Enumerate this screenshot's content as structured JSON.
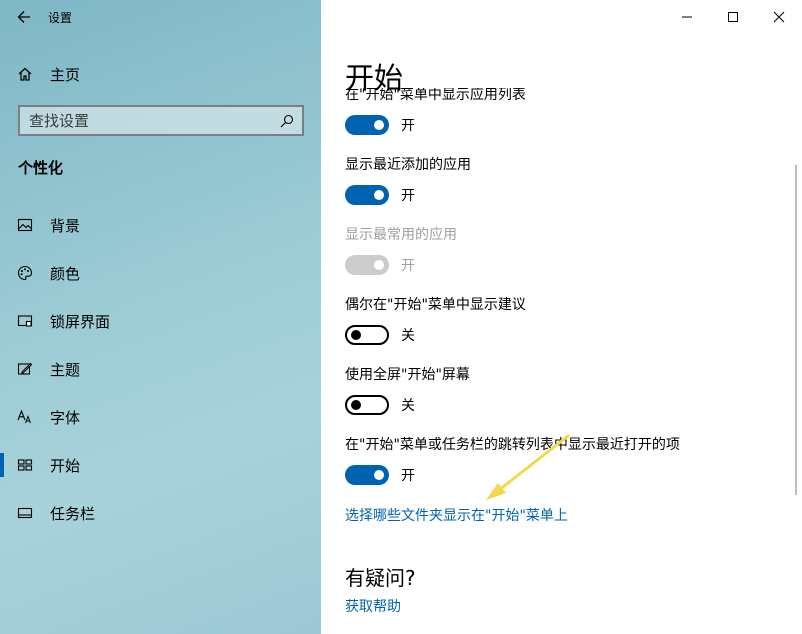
{
  "window": {
    "title": "设置"
  },
  "sidebar": {
    "home_label": "主页",
    "search_placeholder": "查找设置",
    "section_heading": "个性化",
    "items": [
      {
        "label": "背景",
        "icon": "image-icon"
      },
      {
        "label": "颜色",
        "icon": "palette-icon"
      },
      {
        "label": "锁屏界面",
        "icon": "lock-screen-icon"
      },
      {
        "label": "主题",
        "icon": "theme-icon"
      },
      {
        "label": "字体",
        "icon": "font-icon"
      },
      {
        "label": "开始",
        "icon": "start-icon",
        "active": true
      },
      {
        "label": "任务栏",
        "icon": "taskbar-icon"
      }
    ]
  },
  "content": {
    "page_title": "开始",
    "settings": [
      {
        "label": "在\"开始\"菜单中显示应用列表",
        "state": "开",
        "on": true,
        "enabled": true
      },
      {
        "label": "显示最近添加的应用",
        "state": "开",
        "on": true,
        "enabled": true
      },
      {
        "label": "显示最常用的应用",
        "state": "开",
        "on": true,
        "enabled": false
      },
      {
        "label": "偶尔在\"开始\"菜单中显示建议",
        "state": "关",
        "on": false,
        "enabled": true
      },
      {
        "label": "使用全屏\"开始\"屏幕",
        "state": "关",
        "on": false,
        "enabled": true
      },
      {
        "label": "在\"开始\"菜单或任务栏的跳转列表中显示最近打开的项",
        "state": "开",
        "on": true,
        "enabled": true
      }
    ],
    "folders_link": "选择哪些文件夹显示在\"开始\"菜单上",
    "help_heading": "有疑问?",
    "help_link": "获取帮助"
  },
  "colors": {
    "accent": "#0063b1",
    "annotation_arrow": "#f2d84a"
  }
}
